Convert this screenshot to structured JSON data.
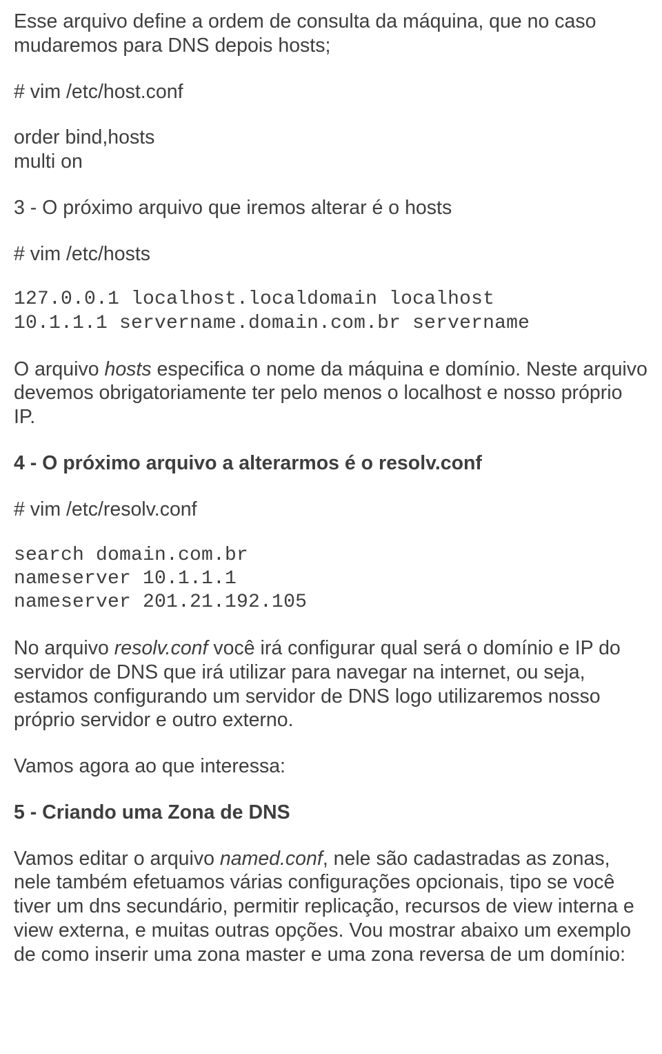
{
  "p1": "Esse arquivo define a ordem de consulta da máquina, que no caso mudaremos para DNS depois hosts;",
  "p2": "# vim /etc/host.conf",
  "p3_l1": "order bind,hosts",
  "p3_l2": "multi on",
  "p4": "3 - O próximo arquivo que iremos alterar é o hosts",
  "p5": "# vim /etc/hosts",
  "p6_l1": "127.0.0.1 localhost.localdomain localhost",
  "p6_l2": "10.1.1.1 servername.domain.com.br servername",
  "p7_a": "O arquivo ",
  "p7_b": "hosts",
  "p7_c": " especifica o nome da máquina e domínio. Neste arquivo devemos obrigatoriamente ter pelo menos o localhost e nosso próprio IP.",
  "p8": "4 - O próximo arquivo a alterarmos é o resolv.conf",
  "p9": "# vim /etc/resolv.conf",
  "p10_l1": "search domain.com.br",
  "p10_l2": "nameserver 10.1.1.1",
  "p10_l3": "nameserver 201.21.192.105",
  "p11_a": "No arquivo ",
  "p11_b": "resolv.conf",
  "p11_c": " você irá configurar qual será o domínio e IP do servidor de DNS que irá utilizar para navegar na internet, ou seja, estamos configurando um servidor de DNS logo utilizaremos nosso próprio servidor e outro externo.",
  "p12": "Vamos agora ao que interessa:",
  "p13": "5 - Criando uma Zona de DNS",
  "p14_a": "Vamos editar o arquivo ",
  "p14_b": "named.conf",
  "p14_c": ", nele são cadastradas as zonas, nele também efetuamos várias configurações opcionais, tipo se você tiver um dns secundário, permitir replicação, recursos de view interna e view externa, e muitas outras opções. Vou mostrar abaixo um exemplo de como inserir uma zona master e uma zona reversa de um domínio:"
}
